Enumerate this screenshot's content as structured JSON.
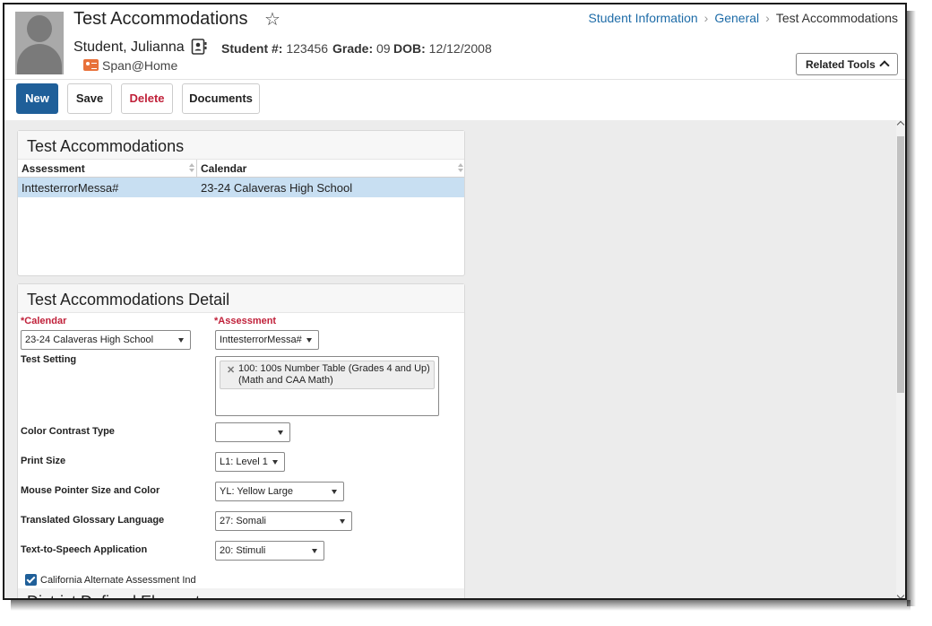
{
  "header": {
    "title": "Test Accommodations",
    "student_name": "Student, Julianna",
    "student_number_label": "Student #:",
    "student_number": "123456",
    "grade_label": "Grade:",
    "grade": "09",
    "dob_label": "DOB:",
    "dob": "12/12/2008",
    "program": "Span@Home",
    "related_tools": "Related Tools"
  },
  "breadcrumb": [
    "Student Information",
    "General",
    "Test Accommodations"
  ],
  "toolbar": {
    "new_label": "New",
    "save_label": "Save",
    "delete_label": "Delete",
    "documents_label": "Documents"
  },
  "list_panel": {
    "title": "Test Accommodations",
    "columns": [
      "Assessment",
      "Calendar"
    ],
    "rows": [
      [
        "InttesterrorMessa#",
        "23-24 Calaveras High School"
      ]
    ]
  },
  "detail_panel": {
    "title": "Test Accommodations Detail",
    "calendar_label": "*Calendar",
    "calendar_value": "23-24 Calaveras High School",
    "assessment_label": "*Assessment",
    "assessment_value": "InttesterrorMessa#",
    "test_setting_label": "Test Setting",
    "test_setting_chip_line1": "100: 100s Number Table (Grades 4 and Up)",
    "test_setting_chip_line2": "(Math and CAA Math)",
    "color_contrast_label": "Color Contrast Type",
    "color_contrast_value": "",
    "print_size_label": "Print Size",
    "print_size_value": "L1: Level 1",
    "mouse_pointer_label": "Mouse Pointer Size and Color",
    "mouse_pointer_value": "YL: Yellow Large",
    "glossary_label": "Translated Glossary Language",
    "glossary_value": "27: Somali",
    "tts_label": "Text-to-Speech Application",
    "tts_value": "20: Stimuli",
    "caa_label": "California Alternate Assessment Ind",
    "caa_checked": true,
    "district_section_title": "District Defined Elements"
  },
  "colors": {
    "primary": "#1f5f99",
    "link": "#1e6ca8",
    "danger": "#c0213a",
    "selected_row": "#c8dff2",
    "badge": "#e8713a"
  }
}
